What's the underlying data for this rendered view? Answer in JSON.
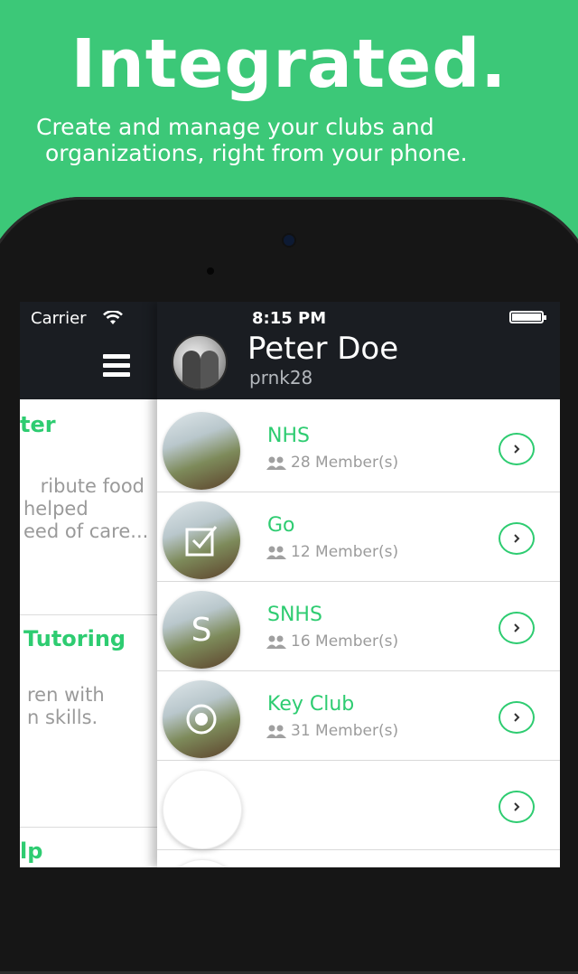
{
  "promo": {
    "headline": "Integrated.",
    "subline_1": "Create and manage your clubs and",
    "subline_2": "organizations, right from your phone."
  },
  "status_bar": {
    "carrier": "Carrier",
    "time": "8:15 PM"
  },
  "profile": {
    "name": "Peter Doe",
    "handle": "prnk28"
  },
  "drawer": {
    "items": [
      {
        "title": "ter",
        "desc_1": "ribute food",
        "desc_2": "helped",
        "desc_3": "eed of care..."
      },
      {
        "title": "Tutoring",
        "desc_1": "ren with",
        "desc_2": "n skills."
      },
      {
        "title": "lp"
      }
    ]
  },
  "clubs": [
    {
      "name": "NHS",
      "members": "28 Member(s)"
    },
    {
      "name": "Go",
      "members": "12 Member(s)"
    },
    {
      "name": "SNHS",
      "members": "16 Member(s)",
      "initial": "S"
    },
    {
      "name": "Key Club",
      "members": "31 Member(s)"
    },
    {
      "name": "",
      "members": ""
    }
  ],
  "colors": {
    "brand_green": "#3cc878",
    "accent_green": "#2ecc71",
    "nav_dark": "#1a1d22"
  },
  "icons": {
    "menu": "hamburger-icon",
    "row_action": "chevron-right-icon",
    "members": "members-icon",
    "wifi": "wifi-icon",
    "battery": "battery-icon"
  }
}
